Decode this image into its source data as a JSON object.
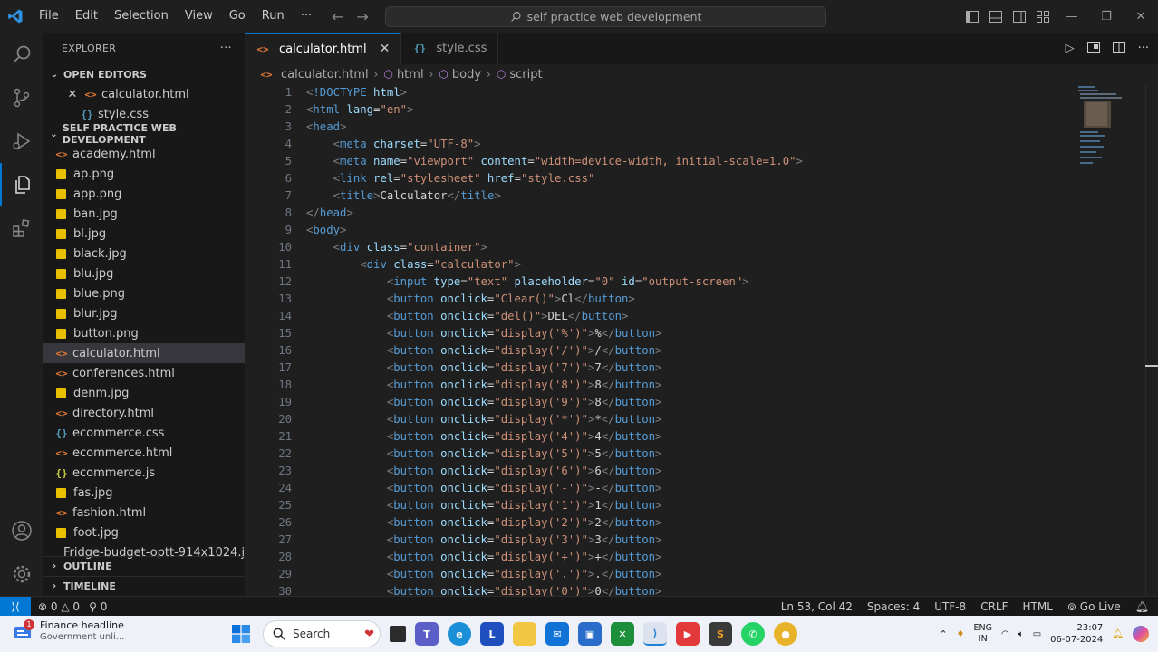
{
  "menu": [
    "File",
    "Edit",
    "Selection",
    "View",
    "Go",
    "Run",
    "···"
  ],
  "command_center": "self practice web development",
  "explorer": {
    "title": "EXPLORER",
    "more": "···",
    "open_editors_label": "OPEN EDITORS",
    "open_editors": [
      {
        "name": "calculator.html",
        "type": "html",
        "close": "✕"
      },
      {
        "name": "style.css",
        "type": "css"
      }
    ],
    "folder_label": "SELF PRACTICE WEB DEVELOPMENT",
    "files": [
      {
        "name": "academy.html",
        "type": "html"
      },
      {
        "name": "ap.png",
        "type": "img"
      },
      {
        "name": "app.png",
        "type": "img"
      },
      {
        "name": "ban.jpg",
        "type": "img"
      },
      {
        "name": "bl.jpg",
        "type": "img"
      },
      {
        "name": "black.jpg",
        "type": "img"
      },
      {
        "name": "blu.jpg",
        "type": "img"
      },
      {
        "name": "blue.png",
        "type": "img"
      },
      {
        "name": "blur.jpg",
        "type": "img"
      },
      {
        "name": "button.png",
        "type": "img"
      },
      {
        "name": "calculator.html",
        "type": "html",
        "selected": true
      },
      {
        "name": "conferences.html",
        "type": "html"
      },
      {
        "name": "denm.jpg",
        "type": "img"
      },
      {
        "name": "directory.html",
        "type": "html"
      },
      {
        "name": "ecommerce.css",
        "type": "css"
      },
      {
        "name": "ecommerce.html",
        "type": "html"
      },
      {
        "name": "ecommerce.js",
        "type": "js"
      },
      {
        "name": "fas.jpg",
        "type": "img"
      },
      {
        "name": "fashion.html",
        "type": "html"
      },
      {
        "name": "foot.jpg",
        "type": "img"
      },
      {
        "name": "Fridge-budget-optt-914x1024.j...",
        "type": "img"
      }
    ],
    "outline_label": "OUTLINE",
    "timeline_label": "TIMELINE"
  },
  "tabs": [
    {
      "label": "calculator.html",
      "type": "html",
      "active": true,
      "close": "✕"
    },
    {
      "label": "style.css",
      "type": "css",
      "active": false
    }
  ],
  "breadcrumb": [
    "calculator.html",
    "html",
    "body",
    "script"
  ],
  "code_lines": [
    [
      [
        "tg",
        "<"
      ],
      [
        "tn",
        "!DOCTYPE"
      ],
      [
        "an",
        " html"
      ],
      [
        "tg",
        ">"
      ]
    ],
    [
      [
        "tg",
        "<"
      ],
      [
        "tn",
        "html"
      ],
      [
        "an",
        " lang"
      ],
      [
        "tx",
        "="
      ],
      [
        "av",
        "\"en\""
      ],
      [
        "tg",
        ">"
      ]
    ],
    [
      [
        "tg",
        "<"
      ],
      [
        "tn",
        "head"
      ],
      [
        "tg",
        ">"
      ]
    ],
    [
      [
        "tx",
        "    "
      ],
      [
        "tg",
        "<"
      ],
      [
        "tn",
        "meta"
      ],
      [
        "an",
        " charset"
      ],
      [
        "tx",
        "="
      ],
      [
        "av",
        "\"UTF-8\""
      ],
      [
        "tg",
        ">"
      ]
    ],
    [
      [
        "tx",
        "    "
      ],
      [
        "tg",
        "<"
      ],
      [
        "tn",
        "meta"
      ],
      [
        "an",
        " name"
      ],
      [
        "tx",
        "="
      ],
      [
        "av",
        "\"viewport\""
      ],
      [
        "an",
        " content"
      ],
      [
        "tx",
        "="
      ],
      [
        "av",
        "\"width=device-width, initial-scale=1.0\""
      ],
      [
        "tg",
        ">"
      ]
    ],
    [
      [
        "tx",
        "    "
      ],
      [
        "tg",
        "<"
      ],
      [
        "tn",
        "link"
      ],
      [
        "an",
        " rel"
      ],
      [
        "tx",
        "="
      ],
      [
        "av",
        "\"stylesheet\""
      ],
      [
        "an",
        " href"
      ],
      [
        "tx",
        "="
      ],
      [
        "av",
        "\"style.css\""
      ]
    ],
    [
      [
        "tx",
        "    "
      ],
      [
        "tg",
        "<"
      ],
      [
        "tn",
        "title"
      ],
      [
        "tg",
        ">"
      ],
      [
        "tx",
        "Calculator"
      ],
      [
        "tg",
        "</"
      ],
      [
        "tn",
        "title"
      ],
      [
        "tg",
        ">"
      ]
    ],
    [
      [
        "tg",
        "</"
      ],
      [
        "tn",
        "head"
      ],
      [
        "tg",
        ">"
      ]
    ],
    [
      [
        "tg",
        "<"
      ],
      [
        "tn",
        "body"
      ],
      [
        "tg",
        ">"
      ]
    ],
    [
      [
        "tx",
        "    "
      ],
      [
        "tg",
        "<"
      ],
      [
        "tn",
        "div"
      ],
      [
        "an",
        " class"
      ],
      [
        "tx",
        "="
      ],
      [
        "av",
        "\"container\""
      ],
      [
        "tg",
        ">"
      ]
    ],
    [
      [
        "tx",
        "        "
      ],
      [
        "tg",
        "<"
      ],
      [
        "tn",
        "div"
      ],
      [
        "an",
        " class"
      ],
      [
        "tx",
        "="
      ],
      [
        "av",
        "\"calculator\""
      ],
      [
        "tg",
        ">"
      ]
    ],
    [
      [
        "tx",
        "            "
      ],
      [
        "tg",
        "<"
      ],
      [
        "tn",
        "input"
      ],
      [
        "an",
        " type"
      ],
      [
        "tx",
        "="
      ],
      [
        "av",
        "\"text\""
      ],
      [
        "an",
        " placeholder"
      ],
      [
        "tx",
        "="
      ],
      [
        "av",
        "\"0\""
      ],
      [
        "an",
        " id"
      ],
      [
        "tx",
        "="
      ],
      [
        "av",
        "\"output-screen\""
      ],
      [
        "tg",
        ">"
      ]
    ],
    [
      [
        "tx",
        "            "
      ],
      [
        "tg",
        "<"
      ],
      [
        "tn",
        "button"
      ],
      [
        "an",
        " onclick"
      ],
      [
        "tx",
        "="
      ],
      [
        "av",
        "\"Clear()\""
      ],
      [
        "tg",
        ">"
      ],
      [
        "tx",
        "Cl"
      ],
      [
        "tg",
        "</"
      ],
      [
        "tn",
        "button"
      ],
      [
        "tg",
        ">"
      ]
    ],
    [
      [
        "tx",
        "            "
      ],
      [
        "tg",
        "<"
      ],
      [
        "tn",
        "button"
      ],
      [
        "an",
        " onclick"
      ],
      [
        "tx",
        "="
      ],
      [
        "av",
        "\"del()\""
      ],
      [
        "tg",
        ">"
      ],
      [
        "tx",
        "DEL"
      ],
      [
        "tg",
        "</"
      ],
      [
        "tn",
        "button"
      ],
      [
        "tg",
        ">"
      ]
    ],
    [
      [
        "tx",
        "            "
      ],
      [
        "tg",
        "<"
      ],
      [
        "tn",
        "button"
      ],
      [
        "an",
        " onclick"
      ],
      [
        "tx",
        "="
      ],
      [
        "av",
        "\"display('%')\""
      ],
      [
        "tg",
        ">"
      ],
      [
        "tx",
        "%"
      ],
      [
        "tg",
        "</"
      ],
      [
        "tn",
        "button"
      ],
      [
        "tg",
        ">"
      ]
    ],
    [
      [
        "tx",
        "            "
      ],
      [
        "tg",
        "<"
      ],
      [
        "tn",
        "button"
      ],
      [
        "an",
        " onclick"
      ],
      [
        "tx",
        "="
      ],
      [
        "av",
        "\"display('/')\""
      ],
      [
        "tg",
        ">"
      ],
      [
        "tx",
        "/"
      ],
      [
        "tg",
        "</"
      ],
      [
        "tn",
        "button"
      ],
      [
        "tg",
        ">"
      ]
    ],
    [
      [
        "tx",
        "            "
      ],
      [
        "tg",
        "<"
      ],
      [
        "tn",
        "button"
      ],
      [
        "an",
        " onclick"
      ],
      [
        "tx",
        "="
      ],
      [
        "av",
        "\"display('7')\""
      ],
      [
        "tg",
        ">"
      ],
      [
        "tx",
        "7"
      ],
      [
        "tg",
        "</"
      ],
      [
        "tn",
        "button"
      ],
      [
        "tg",
        ">"
      ]
    ],
    [
      [
        "tx",
        "            "
      ],
      [
        "tg",
        "<"
      ],
      [
        "tn",
        "button"
      ],
      [
        "an",
        " onclick"
      ],
      [
        "tx",
        "="
      ],
      [
        "av",
        "\"display('8')\""
      ],
      [
        "tg",
        ">"
      ],
      [
        "tx",
        "8"
      ],
      [
        "tg",
        "</"
      ],
      [
        "tn",
        "button"
      ],
      [
        "tg",
        ">"
      ]
    ],
    [
      [
        "tx",
        "            "
      ],
      [
        "tg",
        "<"
      ],
      [
        "tn",
        "button"
      ],
      [
        "an",
        " onclick"
      ],
      [
        "tx",
        "="
      ],
      [
        "av",
        "\"display('9')\""
      ],
      [
        "tg",
        ">"
      ],
      [
        "tx",
        "8"
      ],
      [
        "tg",
        "</"
      ],
      [
        "tn",
        "button"
      ],
      [
        "tg",
        ">"
      ]
    ],
    [
      [
        "tx",
        "            "
      ],
      [
        "tg",
        "<"
      ],
      [
        "tn",
        "button"
      ],
      [
        "an",
        " onclick"
      ],
      [
        "tx",
        "="
      ],
      [
        "av",
        "\"display('*')\""
      ],
      [
        "tg",
        ">"
      ],
      [
        "tx",
        "*"
      ],
      [
        "tg",
        "</"
      ],
      [
        "tn",
        "button"
      ],
      [
        "tg",
        ">"
      ]
    ],
    [
      [
        "tx",
        "            "
      ],
      [
        "tg",
        "<"
      ],
      [
        "tn",
        "button"
      ],
      [
        "an",
        " onclick"
      ],
      [
        "tx",
        "="
      ],
      [
        "av",
        "\"display('4')\""
      ],
      [
        "tg",
        ">"
      ],
      [
        "tx",
        "4"
      ],
      [
        "tg",
        "</"
      ],
      [
        "tn",
        "button"
      ],
      [
        "tg",
        ">"
      ]
    ],
    [
      [
        "tx",
        "            "
      ],
      [
        "tg",
        "<"
      ],
      [
        "tn",
        "button"
      ],
      [
        "an",
        " onclick"
      ],
      [
        "tx",
        "="
      ],
      [
        "av",
        "\"display('5')\""
      ],
      [
        "tg",
        ">"
      ],
      [
        "tx",
        "5"
      ],
      [
        "tg",
        "</"
      ],
      [
        "tn",
        "button"
      ],
      [
        "tg",
        ">"
      ]
    ],
    [
      [
        "tx",
        "            "
      ],
      [
        "tg",
        "<"
      ],
      [
        "tn",
        "button"
      ],
      [
        "an",
        " onclick"
      ],
      [
        "tx",
        "="
      ],
      [
        "av",
        "\"display('6')\""
      ],
      [
        "tg",
        ">"
      ],
      [
        "tx",
        "6"
      ],
      [
        "tg",
        "</"
      ],
      [
        "tn",
        "button"
      ],
      [
        "tg",
        ">"
      ]
    ],
    [
      [
        "tx",
        "            "
      ],
      [
        "tg",
        "<"
      ],
      [
        "tn",
        "button"
      ],
      [
        "an",
        " onclick"
      ],
      [
        "tx",
        "="
      ],
      [
        "av",
        "\"display('-')\""
      ],
      [
        "tg",
        ">"
      ],
      [
        "tx",
        "-"
      ],
      [
        "tg",
        "</"
      ],
      [
        "tn",
        "button"
      ],
      [
        "tg",
        ">"
      ]
    ],
    [
      [
        "tx",
        "            "
      ],
      [
        "tg",
        "<"
      ],
      [
        "tn",
        "button"
      ],
      [
        "an",
        " onclick"
      ],
      [
        "tx",
        "="
      ],
      [
        "av",
        "\"display('1')\""
      ],
      [
        "tg",
        ">"
      ],
      [
        "tx",
        "1"
      ],
      [
        "tg",
        "</"
      ],
      [
        "tn",
        "button"
      ],
      [
        "tg",
        ">"
      ]
    ],
    [
      [
        "tx",
        "            "
      ],
      [
        "tg",
        "<"
      ],
      [
        "tn",
        "button"
      ],
      [
        "an",
        " onclick"
      ],
      [
        "tx",
        "="
      ],
      [
        "av",
        "\"display('2')\""
      ],
      [
        "tg",
        ">"
      ],
      [
        "tx",
        "2"
      ],
      [
        "tg",
        "</"
      ],
      [
        "tn",
        "button"
      ],
      [
        "tg",
        ">"
      ]
    ],
    [
      [
        "tx",
        "            "
      ],
      [
        "tg",
        "<"
      ],
      [
        "tn",
        "button"
      ],
      [
        "an",
        " onclick"
      ],
      [
        "tx",
        "="
      ],
      [
        "av",
        "\"display('3')\""
      ],
      [
        "tg",
        ">"
      ],
      [
        "tx",
        "3"
      ],
      [
        "tg",
        "</"
      ],
      [
        "tn",
        "button"
      ],
      [
        "tg",
        ">"
      ]
    ],
    [
      [
        "tx",
        "            "
      ],
      [
        "tg",
        "<"
      ],
      [
        "tn",
        "button"
      ],
      [
        "an",
        " onclick"
      ],
      [
        "tx",
        "="
      ],
      [
        "av",
        "\"display('+')\""
      ],
      [
        "tg",
        ">"
      ],
      [
        "tx",
        "+"
      ],
      [
        "tg",
        "</"
      ],
      [
        "tn",
        "button"
      ],
      [
        "tg",
        ">"
      ]
    ],
    [
      [
        "tx",
        "            "
      ],
      [
        "tg",
        "<"
      ],
      [
        "tn",
        "button"
      ],
      [
        "an",
        " onclick"
      ],
      [
        "tx",
        "="
      ],
      [
        "av",
        "\"display('.')\""
      ],
      [
        "tg",
        ">"
      ],
      [
        "tx",
        "."
      ],
      [
        "tg",
        "</"
      ],
      [
        "tn",
        "button"
      ],
      [
        "tg",
        ">"
      ]
    ],
    [
      [
        "tx",
        "            "
      ],
      [
        "tg",
        "<"
      ],
      [
        "tn",
        "button"
      ],
      [
        "an",
        " onclick"
      ],
      [
        "tx",
        "="
      ],
      [
        "av",
        "\"display('0')\""
      ],
      [
        "tg",
        ">"
      ],
      [
        "tx",
        "0"
      ],
      [
        "tg",
        "</"
      ],
      [
        "tn",
        "button"
      ],
      [
        "tg",
        ">"
      ]
    ]
  ],
  "status": {
    "errors": "0",
    "warnings": "0",
    "ports": "0",
    "position": "Ln 53, Col 42",
    "spaces": "Spaces: 4",
    "encoding": "UTF-8",
    "eol": "CRLF",
    "language": "HTML",
    "golive": "Go Live"
  },
  "taskbar": {
    "news_title": "Finance headline",
    "news_sub": "Government unli...",
    "news_badge": "1",
    "search_label": "Search",
    "lang_top": "ENG",
    "lang_bottom": "IN",
    "time": "23:07",
    "date": "06-07-2024"
  },
  "colors": {
    "accent": "#0078d4",
    "html_icon": "#e37933",
    "css_icon": "#519aba",
    "js_icon": "#cbcb41",
    "image_icon": "#e8c000"
  }
}
